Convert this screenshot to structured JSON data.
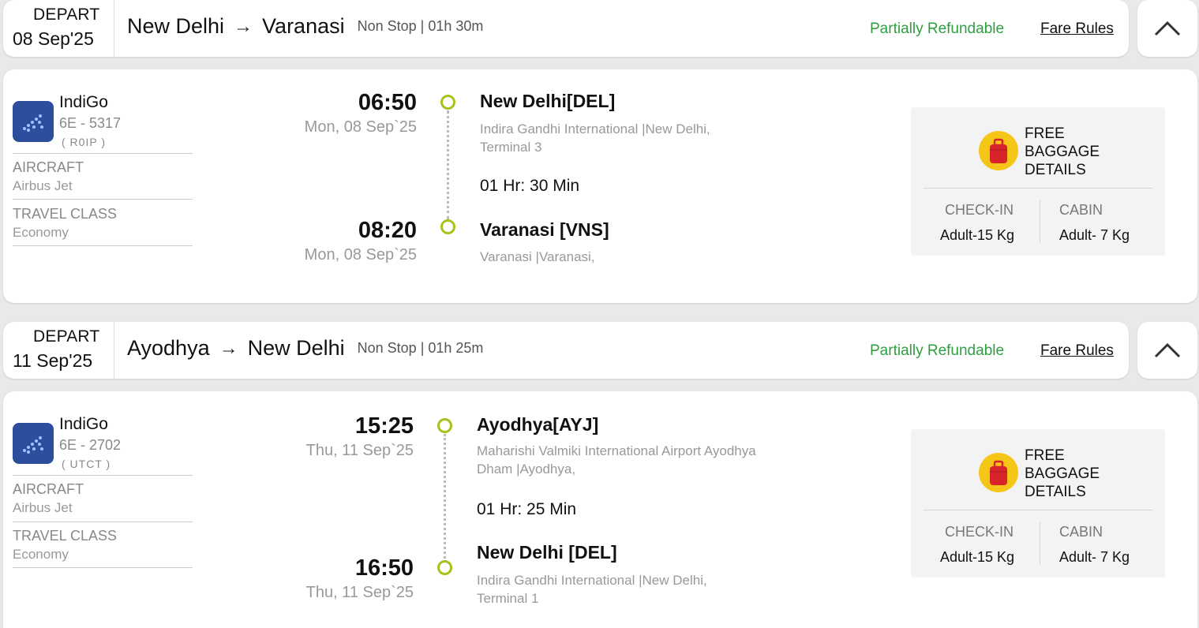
{
  "segments": [
    {
      "header": {
        "depart_label": "DEPART",
        "date": "08 Sep'25",
        "from": "New Delhi",
        "arrow": "→",
        "to": "Varanasi",
        "meta": "Non Stop | 01h 30m",
        "refund": "Partially Refundable",
        "fare_rules": "Fare Rules"
      },
      "flight": {
        "airline": "IndiGo",
        "number": "6E - 5317",
        "code": "( R0IP )",
        "aircraft_label": "AIRCRAFT",
        "aircraft_value": "Airbus Jet",
        "class_label": "TRAVEL CLASS",
        "class_value": "Economy"
      },
      "departure": {
        "time": "06:50",
        "date": "Mon, 08 Sep`25",
        "city": "New Delhi[DEL]",
        "airport": "Indira Gandhi International |New Delhi, Terminal 3"
      },
      "duration": "01 Hr: 30 Min",
      "arrival": {
        "time": "08:20",
        "date": "Mon, 08 Sep`25",
        "city": "Varanasi [VNS]",
        "airport": "Varanasi |Varanasi,"
      },
      "baggage": {
        "title": "FREE BAGGAGE DETAILS",
        "checkin_label": "CHECK-IN",
        "checkin_value": "Adult-15 Kg",
        "cabin_label": "CABIN",
        "cabin_value": "Adult- 7 Kg"
      }
    },
    {
      "header": {
        "depart_label": "DEPART",
        "date": "11 Sep'25",
        "from": "Ayodhya",
        "arrow": "→",
        "to": "New Delhi",
        "meta": "Non Stop | 01h 25m",
        "refund": "Partially Refundable",
        "fare_rules": "Fare Rules"
      },
      "flight": {
        "airline": "IndiGo",
        "number": "6E - 2702",
        "code": "( UTCT )",
        "aircraft_label": "AIRCRAFT",
        "aircraft_value": "Airbus Jet",
        "class_label": "TRAVEL CLASS",
        "class_value": "Economy"
      },
      "departure": {
        "time": "15:25",
        "date": "Thu, 11 Sep`25",
        "city": "Ayodhya[AYJ]",
        "airport": "Maharishi Valmiki International Airport Ayodhya Dham |Ayodhya,"
      },
      "duration": "01 Hr: 25 Min",
      "arrival": {
        "time": "16:50",
        "date": "Thu, 11 Sep`25",
        "city": "New Delhi [DEL]",
        "airport": "Indira Gandhi International |New Delhi, Terminal 1"
      },
      "baggage": {
        "title": "FREE BAGGAGE DETAILS",
        "checkin_label": "CHECK-IN",
        "checkin_value": "Adult-15 Kg",
        "cabin_label": "CABIN",
        "cabin_value": "Adult- 7 Kg"
      }
    }
  ],
  "colors": {
    "refund_green": "#2e9e3f",
    "timeline_dot": "#a6c21b",
    "indigo_blue": "#2d4e9c",
    "baggage_yellow": "#f5c518",
    "baggage_red": "#d8232a"
  },
  "icons": {
    "collapse": "chevron-up-icon",
    "airline_logo": "indigo-logo-icon",
    "baggage": "baggage-icon"
  }
}
